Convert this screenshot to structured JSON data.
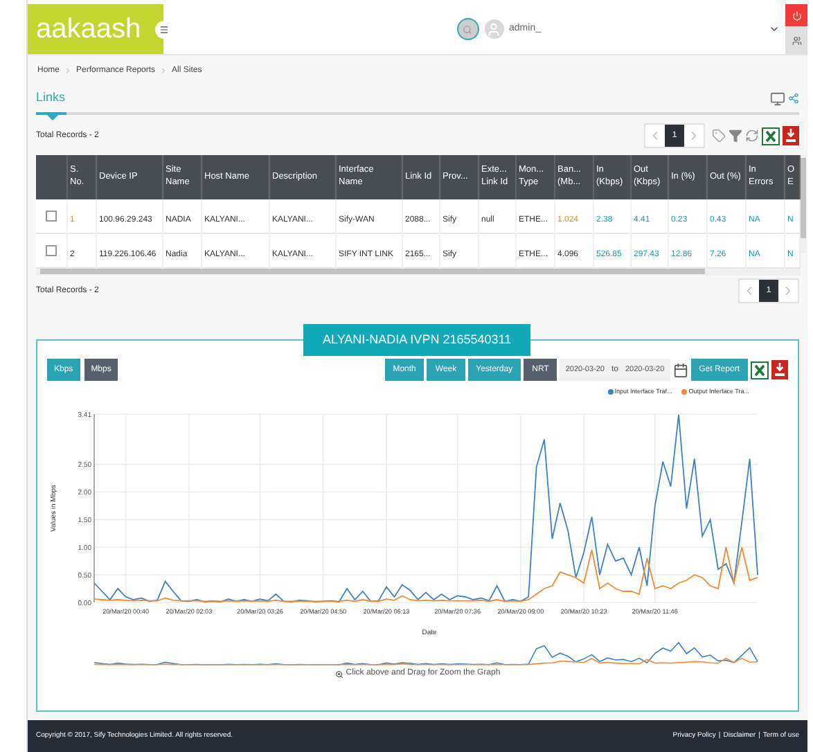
{
  "header": {
    "logo": "aakaash",
    "user": "admin_"
  },
  "breadcrumb": [
    "Home",
    "Performance Reports",
    "All Sites"
  ],
  "page_title": "Links",
  "top_toolbar": {
    "total": "Total Records - 2",
    "pages": [
      {
        "label": "1",
        "selected": true
      }
    ]
  },
  "table": {
    "columns": [
      "S. No.",
      "Device IP",
      "Site Name",
      "Host Name",
      "Description",
      "Interface Name",
      "Link Id",
      "Prov...",
      "Exte... Link Id",
      "Mon... Type",
      "Ban... (Mb...",
      "In (Kbps)",
      "Out (Kbps)",
      "In (%)",
      "Out (%)",
      "In Errors",
      "O E"
    ],
    "rows": [
      {
        "checked": false,
        "cells": [
          {
            "text": "1",
            "kind": "accent"
          },
          {
            "text": "100.96.29.243",
            "kind": "text"
          },
          {
            "text": "NADIA",
            "kind": "text"
          },
          {
            "text": "KALYANI...",
            "kind": "text"
          },
          {
            "text": "KALYANI...",
            "kind": "text"
          },
          {
            "text": "Sify-WAN",
            "kind": "text"
          },
          {
            "text": "2088...",
            "kind": "text"
          },
          {
            "text": "Sify",
            "kind": "text"
          },
          {
            "text": "null",
            "kind": "text"
          },
          {
            "text": "ETHE...",
            "kind": "text"
          },
          {
            "text": "1.024",
            "kind": "accent"
          },
          {
            "text": "2.38",
            "kind": "link"
          },
          {
            "text": "4.41",
            "kind": "link"
          },
          {
            "text": "0.23",
            "kind": "link"
          },
          {
            "text": "0.43",
            "kind": "link"
          },
          {
            "text": "NA",
            "kind": "link"
          },
          {
            "text": "N",
            "kind": "link"
          }
        ]
      },
      {
        "checked": false,
        "cells": [
          {
            "text": "2",
            "kind": "text"
          },
          {
            "text": "119.226.106.46",
            "kind": "text"
          },
          {
            "text": "Nadia",
            "kind": "text"
          },
          {
            "text": "KALYANI...",
            "kind": "text"
          },
          {
            "text": "KALYANI...",
            "kind": "text"
          },
          {
            "text": "SIFY INT LINK",
            "kind": "text"
          },
          {
            "text": "2165...",
            "kind": "text"
          },
          {
            "text": "Sify",
            "kind": "text"
          },
          {
            "kind": "empty"
          },
          {
            "text": "ETHE...",
            "kind": "text"
          },
          {
            "text": "4.096",
            "kind": "text"
          },
          {
            "text": "526.85",
            "kind": "link"
          },
          {
            "text": "297.43",
            "kind": "link"
          },
          {
            "text": "12.86",
            "kind": "link"
          },
          {
            "text": "7.26",
            "kind": "link"
          },
          {
            "text": "NA",
            "kind": "link"
          },
          {
            "text": "N",
            "kind": "link"
          }
        ]
      }
    ]
  },
  "bottom_toolbar": {
    "total": "Total Records - 2",
    "pages": [
      {
        "label": "1",
        "selected": true
      }
    ]
  },
  "chart_panel": {
    "title": "ALYANI-NADIA IVPN 2165540311",
    "units": [
      {
        "label": "Kbps",
        "selected": false
      },
      {
        "label": "Mbps",
        "selected": true
      }
    ],
    "periods": [
      {
        "label": "Month",
        "selected": false
      },
      {
        "label": "Week",
        "selected": false
      },
      {
        "label": "Yesterday",
        "selected": false
      },
      {
        "label": "NRT",
        "selected": true
      }
    ],
    "date_from": "2020-03-20",
    "date_sep": "to",
    "date_to": "2020-03-20",
    "get_report": "Get Report",
    "chart_data": {
      "type": "line",
      "xlabel": "Date",
      "ylabel": "Values in Mbps",
      "categories": [
        null,
        null,
        null,
        null,
        "20/Mar/20 00:40",
        null,
        null,
        null,
        null,
        null,
        null,
        null,
        "20/Mar/20 02:03",
        null,
        null,
        null,
        null,
        null,
        null,
        null,
        null,
        "20/Mar/20 03:26",
        null,
        null,
        null,
        null,
        null,
        null,
        null,
        "20/Mar/20 04:50",
        null,
        null,
        null,
        null,
        null,
        null,
        null,
        "20/Mar/20 06:13",
        null,
        null,
        null,
        null,
        null,
        null,
        null,
        null,
        "20/Mar/20 07:36",
        null,
        null,
        null,
        null,
        null,
        null,
        null,
        "20/Mar/20 09:00",
        null,
        null,
        null,
        null,
        null,
        null,
        null,
        "20/Mar/20 10:23",
        null,
        null,
        null,
        null,
        null,
        null,
        null,
        null,
        "20/Mar/20 11:46",
        null,
        null,
        null,
        null,
        null,
        null,
        null,
        null,
        null,
        null,
        null,
        null,
        null
      ],
      "series": [
        {
          "name": "Input Interface Traf...",
          "color": "#3a82c4",
          "values": [
            0.35,
            0.2,
            0.05,
            0.25,
            0.1,
            0.05,
            0.08,
            0.02,
            0.04,
            0.38,
            0.2,
            0.03,
            0.02,
            0.05,
            0.01,
            0.02,
            0.01,
            0.06,
            0.02,
            0.05,
            0.02,
            0.06,
            0.03,
            0.15,
            0.02,
            0.01,
            0.04,
            0.03,
            0.01,
            0.02,
            0.03,
            0.01,
            0.25,
            0.05,
            0.2,
            0.02,
            0.03,
            0.28,
            0.1,
            0.32,
            0.22,
            0.05,
            0.18,
            0.05,
            0.15,
            0.05,
            0.12,
            0.1,
            0.05,
            0.08,
            0.03,
            0.3,
            0.02,
            0.05,
            0.02,
            0.1,
            2.45,
            2.95,
            1.15,
            1.8,
            1.3,
            0.45,
            0.9,
            1.55,
            0.5,
            1.05,
            0.75,
            0.8,
            0.5,
            1.0,
            0.3,
            1.75,
            2.55,
            2.1,
            3.4,
            1.7,
            2.6,
            1.2,
            1.5,
            0.6,
            0.7,
            0.35,
            1.45,
            2.6,
            0.5
          ]
        },
        {
          "name": "Output Interface Tra...",
          "color": "#f28a2e",
          "values": [
            0.06,
            0.05,
            0.04,
            0.05,
            0.04,
            0.03,
            0.04,
            0.03,
            0.03,
            0.08,
            0.04,
            0.03,
            0.03,
            0.03,
            0.02,
            0.03,
            0.02,
            0.03,
            0.02,
            0.03,
            0.02,
            0.03,
            0.02,
            0.04,
            0.02,
            0.02,
            0.02,
            0.02,
            0.02,
            0.02,
            0.02,
            0.02,
            0.04,
            0.02,
            0.05,
            0.02,
            0.02,
            0.06,
            0.04,
            0.12,
            0.05,
            0.03,
            0.04,
            0.03,
            0.04,
            0.03,
            0.03,
            0.03,
            0.03,
            0.04,
            0.02,
            0.05,
            0.02,
            0.03,
            0.02,
            0.05,
            0.15,
            0.25,
            0.3,
            0.55,
            0.5,
            0.45,
            0.35,
            0.95,
            0.25,
            0.35,
            0.25,
            0.2,
            0.2,
            0.15,
            0.8,
            0.25,
            0.3,
            0.25,
            0.35,
            0.4,
            0.5,
            0.45,
            0.3,
            0.25,
            1.0,
            0.35,
            1.0,
            0.4,
            0.45
          ]
        }
      ],
      "ylim": [
        0,
        3.41
      ],
      "grid": true,
      "yticks": [
        {
          "value": 0,
          "label": "0.00"
        },
        {
          "value": 0.5,
          "label": "0.50"
        },
        {
          "value": 1,
          "label": "1.00"
        },
        {
          "value": 1.5,
          "label": "1.50"
        },
        {
          "value": 2,
          "label": "2.00"
        },
        {
          "value": 2.5,
          "label": "2.50"
        },
        {
          "value": 3.41,
          "label": "3.41"
        }
      ]
    },
    "hint": "Click above and Drag for Zoom the Graph"
  },
  "footer": {
    "copyright": "Copyright © 2017, Sify Technologies Limited. All rights reserved.",
    "links": [
      {
        "label": "Privacy Policy"
      },
      {
        "label": "Disclaimer",
        "separator": "|"
      },
      {
        "label": "Term of use",
        "separator": "|"
      }
    ]
  }
}
